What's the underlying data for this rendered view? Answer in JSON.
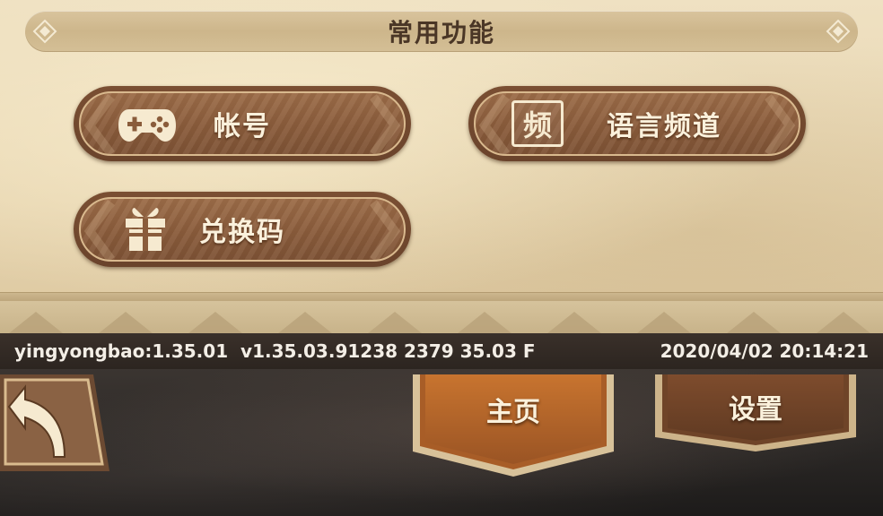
{
  "panel": {
    "title": "常用功能"
  },
  "functions": [
    {
      "label": "帐号",
      "icon": "gamepad-icon"
    },
    {
      "label": "语言频道",
      "icon": "language-channel-icon",
      "icon_glyph": "频"
    },
    {
      "label": "兑换码",
      "icon": "gift-icon"
    }
  ],
  "status_bar": {
    "version": "yingyongbao:1.35.01  v1.35.03.91238 2379 35.03 F",
    "timestamp": "2020/04/02 20:14:21"
  },
  "back_button": {
    "icon": "back-arrow-icon"
  },
  "tabs": [
    {
      "label": "主页",
      "active": true
    },
    {
      "label": "设置",
      "active": false
    }
  ],
  "colors": {
    "parchment": "#e7d5b0",
    "button_brown": "#8a5c3b",
    "button_border": "#d9b98e",
    "title_text": "#4a3626",
    "active_tab": "#b5652a",
    "inactive_tab": "#7a4a2c",
    "status_bar_bg": "#2c2520"
  }
}
